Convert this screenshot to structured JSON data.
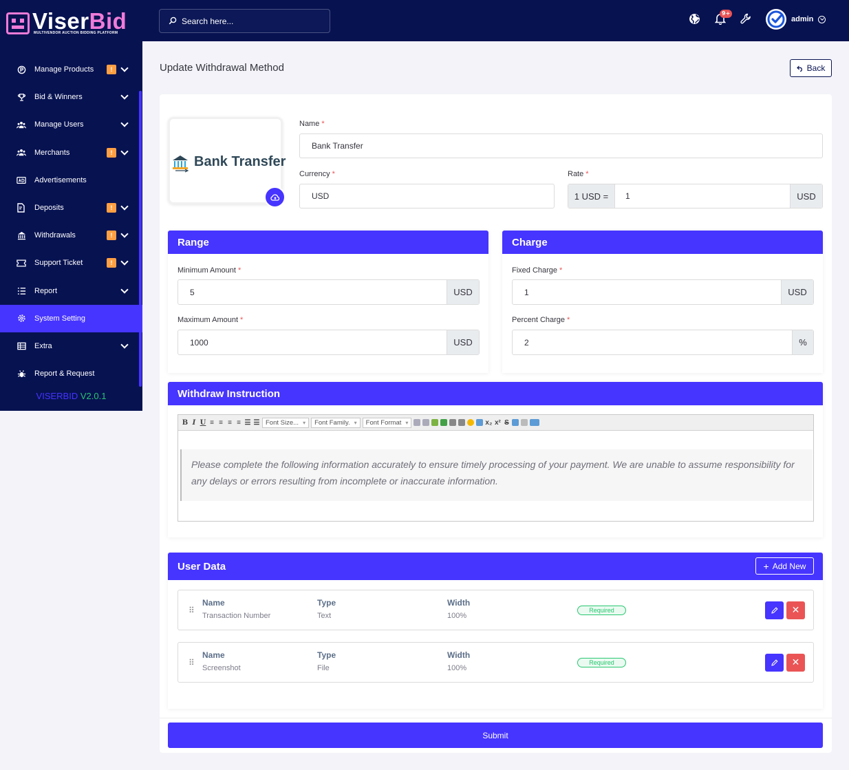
{
  "brand": {
    "name_white": "Viser",
    "name_pink": "Bid",
    "tagline": "MULTIVENDOR AUCTION BIDDING PLATFORM",
    "version_label": "VISERBID",
    "version_number": "V2.0.1"
  },
  "sidebar": {
    "items": [
      {
        "label": "Manage Products",
        "badge": "!",
        "icon": "circle-p-icon"
      },
      {
        "label": "Bid & Winners",
        "badge": "",
        "icon": "trophy-icon"
      },
      {
        "label": "Manage Users",
        "badge": "",
        "icon": "users-icon"
      },
      {
        "label": "Merchants",
        "badge": "!",
        "icon": "users-icon"
      },
      {
        "label": "Advertisements",
        "badge": "",
        "icon": "ad-icon"
      },
      {
        "label": "Deposits",
        "badge": "!",
        "icon": "file-dollar-icon"
      },
      {
        "label": "Withdrawals",
        "badge": "!",
        "icon": "bank-icon"
      },
      {
        "label": "Support Ticket",
        "badge": "!",
        "icon": "ticket-icon"
      },
      {
        "label": "Report",
        "badge": "",
        "icon": "list-icon"
      },
      {
        "label": "System Setting",
        "badge": "",
        "icon": "gear-icon"
      },
      {
        "label": "Extra",
        "badge": "",
        "icon": "server-icon"
      },
      {
        "label": "Report & Request",
        "badge": "",
        "icon": "bug-icon"
      }
    ]
  },
  "topbar": {
    "search_placeholder": "Search here...",
    "notification_count": "9+",
    "username": "admin"
  },
  "page": {
    "title": "Update Withdrawal Method",
    "back_label": "Back"
  },
  "method": {
    "logo_text": "Bank Transfer"
  },
  "form": {
    "name_label": "Name",
    "name_value": "Bank Transfer",
    "currency_label": "Currency",
    "currency_value": "USD",
    "rate_label": "Rate",
    "rate_prefix": "1 USD =",
    "rate_value": "1",
    "rate_suffix": "USD"
  },
  "range": {
    "title": "Range",
    "min_label": "Minimum Amount",
    "min_value": "5",
    "min_suffix": "USD",
    "max_label": "Maximum Amount",
    "max_value": "1000",
    "max_suffix": "USD"
  },
  "charge": {
    "title": "Charge",
    "fixed_label": "Fixed Charge",
    "fixed_value": "1",
    "fixed_suffix": "USD",
    "percent_label": "Percent Charge",
    "percent_value": "2",
    "percent_suffix": "%"
  },
  "instruction": {
    "title": "Withdraw Instruction",
    "toolbar": {
      "font_size": "Font Size...",
      "font_family": "Font Family.",
      "font_format": "Font Format"
    },
    "text": "Please complete the following information accurately to ensure timely processing of your payment. We are unable to assume responsibility for any delays or errors resulting from incomplete or inaccurate information."
  },
  "user_data": {
    "title": "User Data",
    "add_label": "Add New",
    "headers": {
      "name": "Name",
      "type": "Type",
      "width": "Width"
    },
    "rows": [
      {
        "name": "Transaction Number",
        "type": "Text",
        "width": "100%",
        "status": "Required"
      },
      {
        "name": "Screenshot",
        "type": "File",
        "width": "100%",
        "status": "Required"
      }
    ]
  },
  "submit_label": "Submit",
  "colors": {
    "sidebar_bg": "#071251",
    "primary": "#4634ff",
    "warning": "#ff9f43",
    "danger": "#ea5455",
    "success": "#28c76f"
  }
}
